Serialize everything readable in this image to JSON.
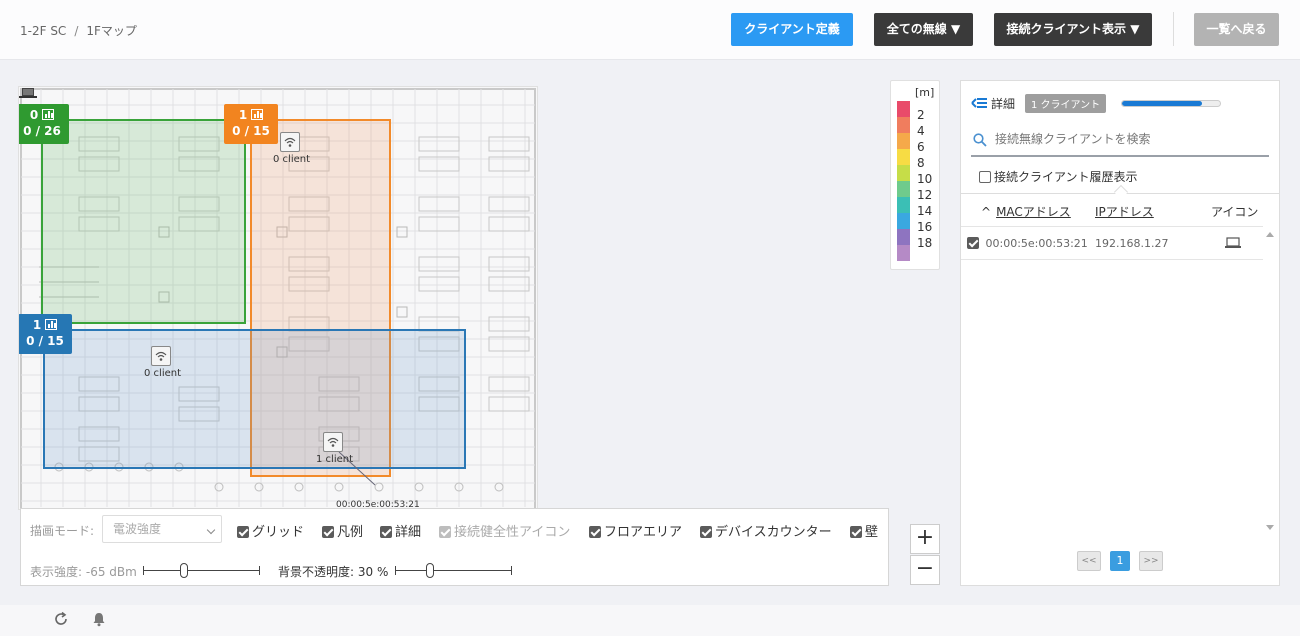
{
  "breadcrumb": {
    "items": [
      "1-2F SC",
      "1Fマップ"
    ],
    "separator": "/"
  },
  "toolbar": {
    "define_client": "クライアント定義",
    "all_wireless": "全ての無線 ▼",
    "show_clients": "接続クライアント表示 ▼",
    "back_to_list": "一覧へ戻る"
  },
  "map": {
    "areas": [
      {
        "color": "#2f9a30",
        "count_top": "0",
        "count_bottom": "0 / 26"
      },
      {
        "color": "#f2841f",
        "count_top": "1",
        "count_bottom": "0 / 15"
      },
      {
        "color": "#2677b4",
        "count_top": "1",
        "count_bottom": "0 / 15"
      }
    ],
    "access_points": [
      {
        "label": "0 client"
      },
      {
        "label": "0 client"
      },
      {
        "label": "1 client"
      }
    ],
    "client_device_label": "00:00:5e:00:53:21"
  },
  "legend": {
    "unit": "[m]",
    "levels": [
      {
        "value": "2",
        "color": "#e94b6a"
      },
      {
        "value": "4",
        "color": "#f07d5e"
      },
      {
        "value": "6",
        "color": "#f5a94a"
      },
      {
        "value": "8",
        "color": "#f7dc44"
      },
      {
        "value": "10",
        "color": "#c6dd48"
      },
      {
        "value": "12",
        "color": "#6fcb8c"
      },
      {
        "value": "14",
        "color": "#3bbfb5"
      },
      {
        "value": "16",
        "color": "#3aa8e0"
      },
      {
        "value": "18",
        "color": "#8e74c0"
      },
      {
        "value": "",
        "color": "#b58ac6"
      }
    ]
  },
  "details": {
    "title": "詳細",
    "client_count_badge": "1 クライアント",
    "progress": 0.82,
    "search_placeholder": "接続無線クライアントを検索",
    "history_label": "接続クライアント履歴表示",
    "columns": {
      "mac": "MACアドレス",
      "ip": "IPアドレス",
      "icon": "アイコン",
      "sort_indicator": "^"
    },
    "rows": [
      {
        "mac": "00:00:5e:00:53:21",
        "ip": "192.168.1.27",
        "icon": "laptop-icon",
        "checked": true
      }
    ],
    "pager": {
      "prev": "<<",
      "current": "1",
      "next": ">>"
    }
  },
  "controls": {
    "mode_label": "描画モード:",
    "mode_value": "電波強度",
    "options": [
      {
        "label": "グリッド",
        "checked": true,
        "disabled": false
      },
      {
        "label": "凡例",
        "checked": true,
        "disabled": false
      },
      {
        "label": "詳細",
        "checked": true,
        "disabled": false
      },
      {
        "label": "接続健全性アイコン",
        "checked": true,
        "disabled": true
      },
      {
        "label": "フロアエリア",
        "checked": true,
        "disabled": false
      },
      {
        "label": "デバイスカウンター",
        "checked": true,
        "disabled": false
      },
      {
        "label": "壁",
        "checked": true,
        "disabled": false
      }
    ],
    "signal_label": "表示強度: -65 dBm",
    "signal_value": 0.35,
    "opacity_label": "背景不透明度: 30 %",
    "opacity_value": 0.3
  },
  "zoom": {
    "in": "+",
    "out": "−"
  }
}
